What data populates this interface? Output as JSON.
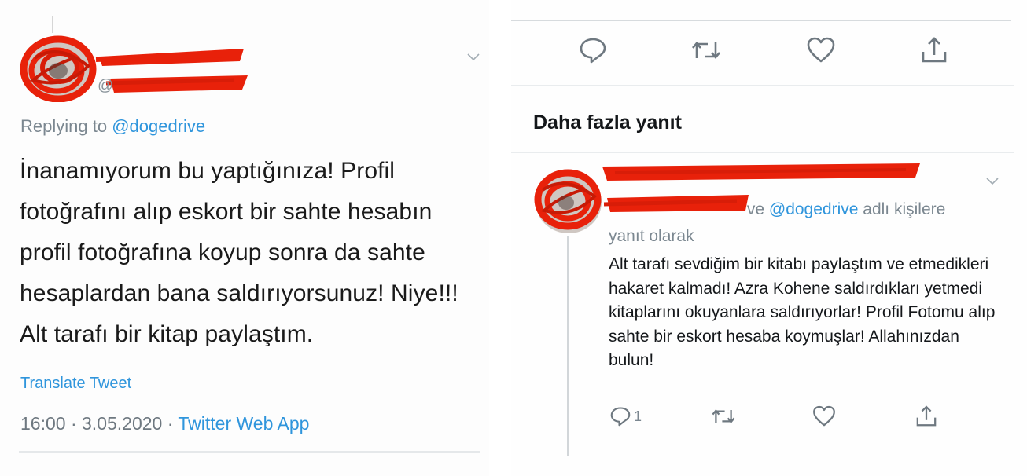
{
  "left_tweet": {
    "replying_prefix": "Replying to",
    "replying_mention": "@dogedrive",
    "body": "İnanamıyorum bu yaptığınıza! Profil fotoğrafını alıp eskort bir sahte hesabın profil fotoğrafına koyup sonra da sahte hesaplardan bana saldırıyorsunuz! Niye!!! Alt tarafı bir kitap paylaştım.",
    "translate_link": "Translate Tweet",
    "time": "16:00",
    "date": "3.05.2020",
    "separator": "·",
    "app": "Twitter Web App",
    "handle_fragment": "@",
    "icons": {
      "menu": "chevron-down-icon"
    }
  },
  "right_panel": {
    "heading": "Daha fazla yanıt",
    "top_actions": [
      "reply-icon",
      "retweet-icon",
      "like-icon",
      "share-icon"
    ],
    "reply": {
      "reply_to_fragment": "ve",
      "reply_to_mention": "@dogedrive",
      "reply_to_suffix_1": "adlı kişilere",
      "reply_to_suffix_2": "yanıt olarak",
      "body": "Alt tarafı sevdiğim bir kitabı paylaştım ve etmedikleri hakaret kalmadı! Azra Kohene saldırdıkları yetmedi kitaplarını okuyanlara saldırıyorlar! Profil Fotomu alıp sahte bir eskort hesaba koymuşlar! Allahınızdan bulun!",
      "reply_count": "1"
    }
  },
  "colors": {
    "link": "#2f95dc",
    "muted": "#7b8790",
    "redaction": "#e8210a",
    "text": "#14171a"
  }
}
